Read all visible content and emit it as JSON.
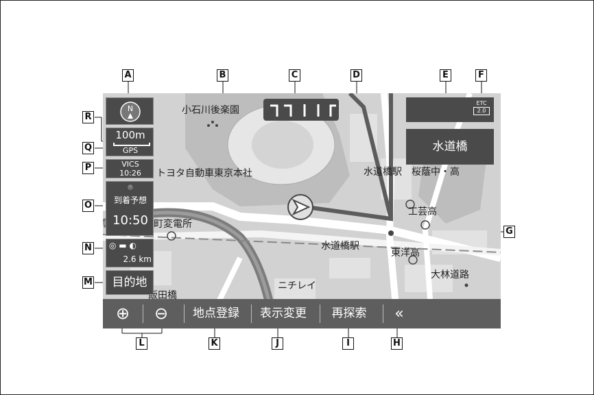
{
  "map_labels": {
    "korakuen": "小石川後楽園",
    "toyota": "トヨタ自動車東京本社",
    "substation": "田町変電所",
    "suidobashi_station_top": "水道橋駅",
    "sakuragaoka": "桜蔭中・高",
    "kogei": "工芸高",
    "suidobashi_station": "水道橋駅",
    "toyo": "東洋高",
    "obayashi": "大林道路",
    "nichirei": "ニチレイ",
    "iidabashi": "飯田橋"
  },
  "left_panel": {
    "scale": "100m",
    "gps": "GPS",
    "vics_label": "VICS",
    "vics_time": "10:26",
    "arrival_label": "到着予想",
    "arrival_time": "10:50",
    "distance": "2.6 km",
    "destination_button": "目的地"
  },
  "top_right": {
    "etc_label": "ETC",
    "etc_version": "2.0",
    "intersection_name": "水道橋"
  },
  "bottom_bar": {
    "zoom_in": "⊕",
    "zoom_out": "⊖",
    "register_point": "地点登録",
    "display_change": "表示変更",
    "research": "再探索",
    "collapse": "«"
  },
  "callouts": {
    "A": "A",
    "B": "B",
    "C": "C",
    "D": "D",
    "E": "E",
    "F": "F",
    "G": "G",
    "H": "H",
    "I": "I",
    "J": "J",
    "K": "K",
    "L": "L",
    "M": "M",
    "N": "N",
    "O": "O",
    "P": "P",
    "Q": "Q",
    "R": "R"
  },
  "icons": [
    "north-compass-icon",
    "lane-guide-icon",
    "current-position-icon",
    "etc-icon",
    "zoom-in-icon",
    "zoom-out-icon",
    "collapse-chevron-icon"
  ]
}
